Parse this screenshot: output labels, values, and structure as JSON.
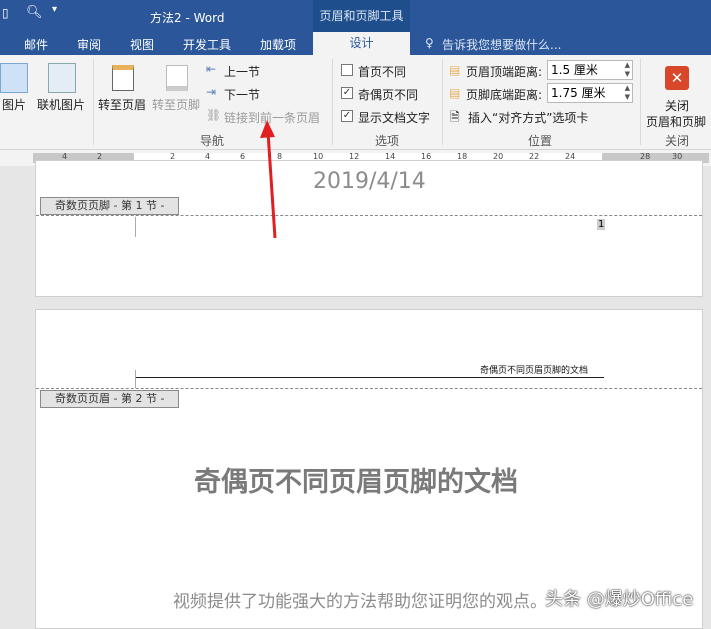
{
  "titlebar": {
    "title": "方法2 - Word",
    "context_group": "页眉和页脚工具"
  },
  "tabs": [
    "邮件",
    "审阅",
    "视图",
    "开发工具",
    "加载项",
    "设计"
  ],
  "tell_me": "告诉我您想要做什么...",
  "ribbon": {
    "insert": {
      "picture": "图片",
      "online_picture": "联机图片"
    },
    "nav": {
      "goto_header": "转至页眉",
      "goto_footer": "转至页脚",
      "previous": "上一节",
      "next": "下一节",
      "link_previous": "链接到前一条页眉",
      "group": "导航"
    },
    "options": {
      "different_first": "首页不同",
      "different_odd_even": "奇偶页不同",
      "show_doc_text": "显示文档文字",
      "group": "选项",
      "checked": [
        false,
        true,
        true
      ]
    },
    "position": {
      "header_from_top": "页眉顶端距离:",
      "header_value": "1.5 厘米",
      "footer_from_bottom": "页脚底端距离:",
      "footer_value": "1.75 厘米",
      "insert_align_tab": "插入“对齐方式”选项卡",
      "group": "位置"
    },
    "close": {
      "close_label": "关闭",
      "close_label2": "页眉和页脚",
      "group": "关闭"
    }
  },
  "ruler": [
    "4",
    "2",
    "2",
    "4",
    "6",
    "8",
    "10",
    "12",
    "14",
    "16",
    "18",
    "20",
    "22",
    "24",
    "28",
    "30"
  ],
  "page1": {
    "date": "2019/4/14",
    "footer_label": "奇数页页脚 - 第 1 节 -",
    "page_num": "1"
  },
  "page2": {
    "header_text": "奇偶页不同页眉页脚的文档",
    "header_label": "奇数页页眉 - 第 2 节 -",
    "title": "奇偶页不同页眉页脚的文档",
    "body": "视频提供了功能强大的方法帮助您证明您的观点。"
  },
  "watermark": "头条 @爆炒Office",
  "colors": {
    "brand": "#2b579a",
    "arrow": "#e02020",
    "close": "#d9472b"
  }
}
